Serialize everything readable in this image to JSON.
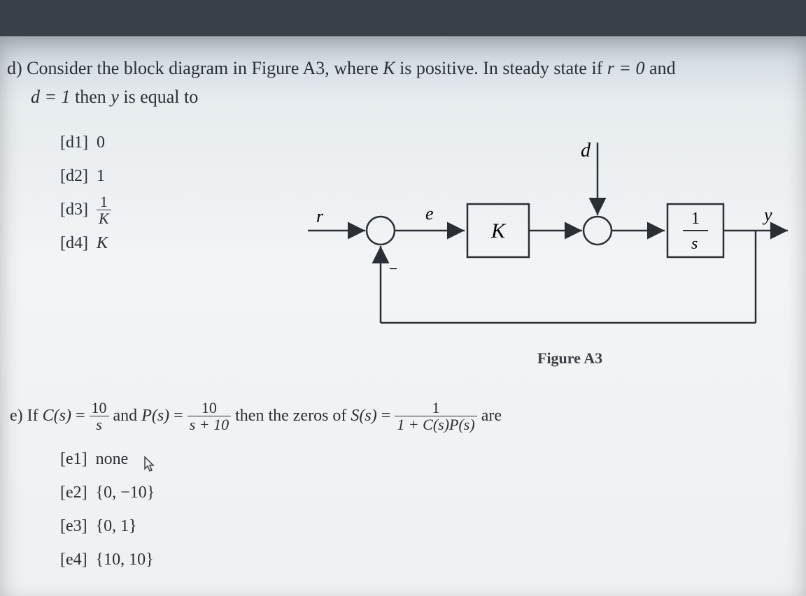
{
  "question_d": {
    "prefix": "d) ",
    "line1_a": "Consider the block diagram in Figure A3, where ",
    "K": "K",
    "line1_b": " is positive.  In steady state if ",
    "cond_r": "r = 0",
    "and": " and",
    "cond_d": "d = 1",
    "line2_a": " then ",
    "y": "y",
    "line2_b": " is equal to",
    "options": {
      "d1": {
        "tag": "[d1]",
        "val": "0"
      },
      "d2": {
        "tag": "[d2]",
        "val": "1"
      },
      "d3": {
        "tag": "[d3]",
        "num": "1",
        "den": "K"
      },
      "d4": {
        "tag": "[d4]",
        "val": "K"
      }
    }
  },
  "figure": {
    "r": "r",
    "e": "e",
    "d": "d",
    "y": "y",
    "K": "K",
    "plant_num": "1",
    "plant_den": "s",
    "minus": "−",
    "caption": "Figure A3"
  },
  "question_e": {
    "prefix": "e) If ",
    "C": "C(s)",
    "eq": " = ",
    "c_num": "10",
    "c_den": "s",
    "and": " and ",
    "P": "P(s)",
    "p_num": "10",
    "p_den": "s + 10",
    "then": " then the zeros of ",
    "S": "S(s)",
    "s_num": "1",
    "s_den": "1 + C(s)P(s)",
    "are": " are",
    "options": {
      "e1": {
        "tag": "[e1]",
        "val": "none"
      },
      "e2": {
        "tag": "[e2]",
        "val": "{0, −10}"
      },
      "e3": {
        "tag": "[e3]",
        "val": "{0, 1}"
      },
      "e4": {
        "tag": "[e4]",
        "val": "{10, 10}"
      }
    }
  }
}
